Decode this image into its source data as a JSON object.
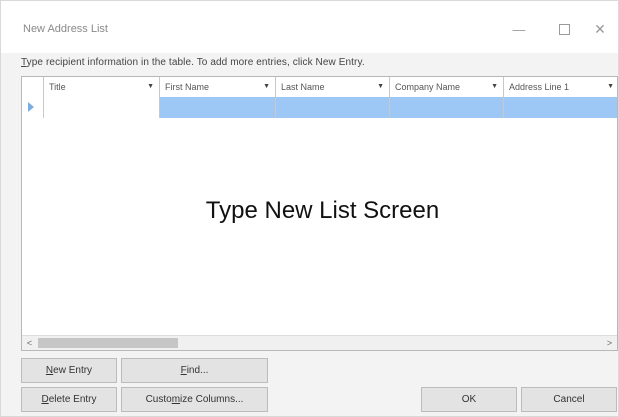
{
  "window": {
    "title": "New Address List",
    "minimize_glyph": "—",
    "close_glyph": "✕"
  },
  "instruction": {
    "accel": "T",
    "rest": "ype recipient information in the table.  To add more entries, click New Entry."
  },
  "table": {
    "columns": [
      {
        "label": "Title"
      },
      {
        "label": "First Name"
      },
      {
        "label": "Last Name"
      },
      {
        "label": "Company Name"
      },
      {
        "label": "Address Line 1"
      }
    ],
    "dropdown_glyph": "▼",
    "rows": [
      {
        "Title": "",
        "First Name": "",
        "Last Name": "",
        "Company Name": "",
        "Address Line 1": ""
      }
    ]
  },
  "overlay_label": "Type New List Screen",
  "scrollbar": {
    "left_glyph": "<",
    "right_glyph": ">"
  },
  "buttons": {
    "new_entry": {
      "accel": "N",
      "rest": "ew Entry"
    },
    "find": {
      "accel": "F",
      "rest": "ind..."
    },
    "delete_entry": {
      "accel": "D",
      "rest": "elete Entry"
    },
    "customize": {
      "pre": "Custo",
      "accel": "m",
      "rest": "ize Columns..."
    },
    "ok": "OK",
    "cancel": "Cancel"
  },
  "colors": {
    "selected_row": "#9dc8f5",
    "row_indicator": "#7aaee0"
  },
  "icons": [
    "minimize-icon",
    "maximize-icon",
    "close-icon",
    "dropdown-arrow-icon",
    "row-indicator-icon",
    "scroll-left-icon",
    "scroll-right-icon"
  ]
}
